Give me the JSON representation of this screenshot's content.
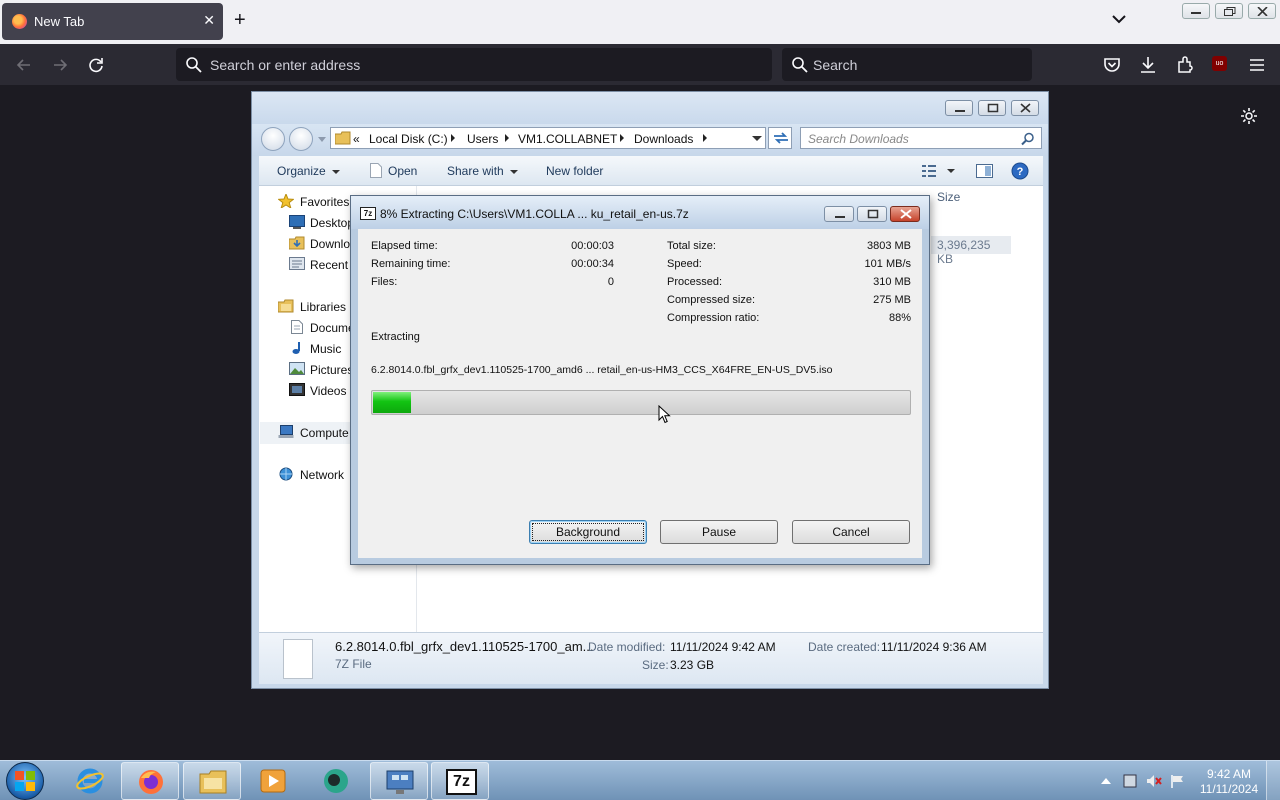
{
  "browser": {
    "tab_title": "New Tab",
    "urlbar_placeholder": "Search or enter address",
    "searchbar_placeholder": "Search",
    "ublock_badge": "uo"
  },
  "explorer": {
    "breadcrumb_prefix": "«",
    "breadcrumb": [
      "Local Disk (C:)",
      "Users",
      "VM1.COLLABNET",
      "Downloads"
    ],
    "search_placeholder": "Search Downloads",
    "toolbar": {
      "organize": "Organize",
      "open": "Open",
      "share_with": "Share with",
      "new_folder": "New folder"
    },
    "nav": {
      "favorites": "Favorites",
      "desktop": "Desktop",
      "downloads": "Downlo",
      "recent": "Recent P",
      "libraries": "Libraries",
      "documents": "Docume",
      "music": "Music",
      "pictures": "Pictures",
      "videos": "Videos",
      "computer": "Compute",
      "network": "Network"
    },
    "column_size": "Size",
    "row_size": "3,396,235 KB",
    "details": {
      "file_name": "6.2.8014.0.fbl_grfx_dev1.110525-1700_am...",
      "file_type": "7Z File",
      "date_modified_label": "Date modified:",
      "date_modified": "11/11/2024 9:42 AM",
      "size_label": "Size:",
      "size": "3.23 GB",
      "date_created_label": "Date created:",
      "date_created": "11/11/2024 9:36 AM"
    }
  },
  "zip": {
    "app_icon": "7z",
    "title": "8% Extracting C:\\Users\\VM1.COLLA ... ku_retail_en-us.7z",
    "elapsed_label": "Elapsed time:",
    "elapsed": "00:00:03",
    "remaining_label": "Remaining time:",
    "remaining": "00:00:34",
    "files_label": "Files:",
    "files": "0",
    "total_size_label": "Total size:",
    "total_size": "3803 MB",
    "speed_label": "Speed:",
    "speed": "101 MB/s",
    "processed_label": "Processed:",
    "processed": "310 MB",
    "compressed_size_label": "Compressed size:",
    "compressed_size": "275 MB",
    "compression_ratio_label": "Compression ratio:",
    "compression_ratio": "88%",
    "status": "Extracting",
    "current_file": "6.2.8014.0.fbl_grfx_dev1.110525-1700_amd6 ... retail_en-us-HM3_CCS_X64FRE_EN-US_DV5.iso",
    "progress": 0.07,
    "buttons": {
      "background": "Background",
      "pause": "Pause",
      "cancel": "Cancel"
    }
  },
  "taskbar": {
    "time": "9:42 AM",
    "date": "11/11/2024",
    "active_app_label": "7z"
  },
  "colors": {
    "firefox_toolbar": "#2b2a33",
    "progress_green": "#12c412",
    "taskbar": "#6f92b6"
  }
}
